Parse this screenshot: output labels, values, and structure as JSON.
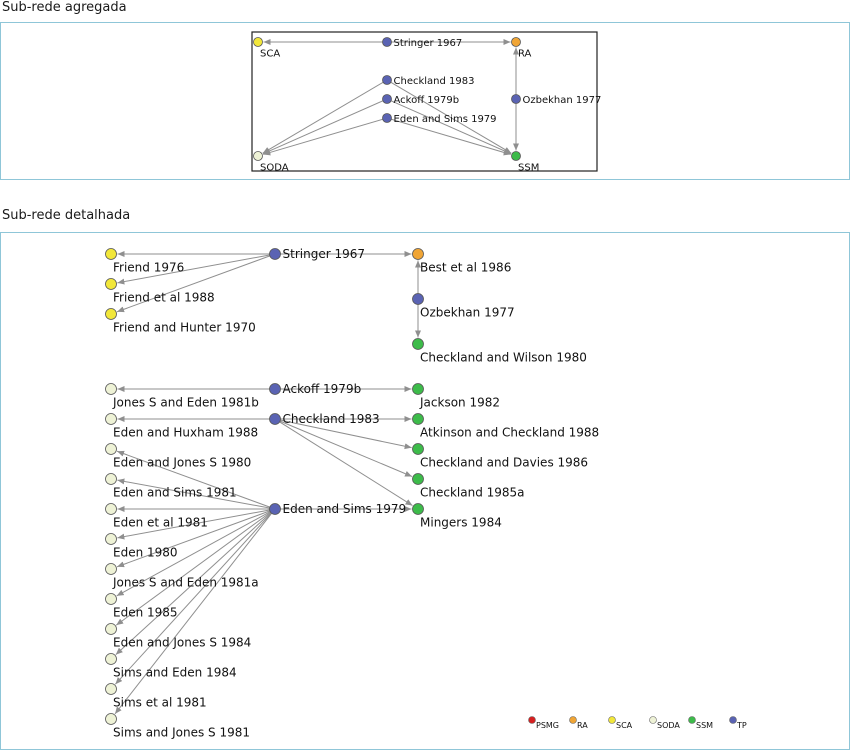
{
  "aggregated": {
    "title": "Sub-rede agregada",
    "nodes": [
      {
        "id": "sca",
        "label": "SCA",
        "group": "SCA"
      },
      {
        "id": "stringer",
        "label": "Stringer 1967",
        "group": "TP"
      },
      {
        "id": "ra",
        "label": "RA",
        "group": "RA"
      },
      {
        "id": "checkland1983",
        "label": "Checkland 1983",
        "group": "TP"
      },
      {
        "id": "ackoff",
        "label": "Ackoff 1979b",
        "group": "TP"
      },
      {
        "id": "edensims",
        "label": "Eden and Sims 1979",
        "group": "TP"
      },
      {
        "id": "ozbekhan",
        "label": "Ozbekhan 1977",
        "group": "TP"
      },
      {
        "id": "soda",
        "label": "SODA",
        "group": "SODA"
      },
      {
        "id": "ssm",
        "label": "SSM",
        "group": "SSM"
      }
    ],
    "edges": [
      [
        "stringer",
        "sca"
      ],
      [
        "stringer",
        "ra"
      ],
      [
        "ozbekhan",
        "ra"
      ],
      [
        "ozbekhan",
        "ssm"
      ],
      [
        "checkland1983",
        "soda"
      ],
      [
        "ackoff",
        "soda"
      ],
      [
        "edensims",
        "soda"
      ],
      [
        "checkland1983",
        "ssm"
      ],
      [
        "ackoff",
        "ssm"
      ],
      [
        "edensims",
        "ssm"
      ]
    ]
  },
  "detailed": {
    "title": "Sub-rede detalhada",
    "nodes": [
      {
        "id": "friend1976",
        "label": "Friend 1976",
        "group": "SCA"
      },
      {
        "id": "friendetal1988",
        "label": "Friend et al 1988",
        "group": "SCA"
      },
      {
        "id": "friendhunter1970",
        "label": "Friend and Hunter 1970",
        "group": "SCA"
      },
      {
        "id": "stringer1967",
        "label": "Stringer 1967",
        "group": "TP"
      },
      {
        "id": "best1986",
        "label": "Best et al 1986",
        "group": "RA"
      },
      {
        "id": "ozbekhan1977",
        "label": "Ozbekhan 1977",
        "group": "TP"
      },
      {
        "id": "checklandwilson1980",
        "label": "Checkland and Wilson 1980",
        "group": "SSM"
      },
      {
        "id": "jonesseden1981b",
        "label": "Jones S and Eden 1981b",
        "group": "SODA"
      },
      {
        "id": "ackoff1979b",
        "label": "Ackoff 1979b",
        "group": "TP"
      },
      {
        "id": "jackson1982",
        "label": "Jackson 1982",
        "group": "SSM"
      },
      {
        "id": "edenhuxham1988",
        "label": "Eden and Huxham 1988",
        "group": "SODA"
      },
      {
        "id": "checkland1983",
        "label": "Checkland 1983",
        "group": "TP"
      },
      {
        "id": "atkinsoncheckland1988",
        "label": "Atkinson and Checkland 1988",
        "group": "SSM"
      },
      {
        "id": "edenjoness1980",
        "label": "Eden and Jones S 1980",
        "group": "SODA"
      },
      {
        "id": "checklanddavies1986",
        "label": "Checkland and Davies 1986",
        "group": "SSM"
      },
      {
        "id": "edensims1981",
        "label": "Eden and Sims 1981",
        "group": "SODA"
      },
      {
        "id": "checkland1985a",
        "label": "Checkland 1985a",
        "group": "SSM"
      },
      {
        "id": "edenetal1981",
        "label": "Eden et al 1981",
        "group": "SODA"
      },
      {
        "id": "edensims1979",
        "label": "Eden and Sims 1979",
        "group": "TP"
      },
      {
        "id": "mingers1984",
        "label": "Mingers 1984",
        "group": "SSM"
      },
      {
        "id": "eden1980",
        "label": "Eden 1980",
        "group": "SODA"
      },
      {
        "id": "jonesseden1981a",
        "label": "Jones S and Eden 1981a",
        "group": "SODA"
      },
      {
        "id": "eden1985",
        "label": "Eden 1985",
        "group": "SODA"
      },
      {
        "id": "edenjoness1984",
        "label": "Eden and Jones S 1984",
        "group": "SODA"
      },
      {
        "id": "simseden1984",
        "label": "Sims and Eden 1984",
        "group": "SODA"
      },
      {
        "id": "simsetal1981",
        "label": "Sims et al 1981",
        "group": "SODA"
      },
      {
        "id": "simsjoness1981",
        "label": "Sims and Jones S 1981",
        "group": "SODA"
      }
    ],
    "edges": [
      [
        "stringer1967",
        "friend1976"
      ],
      [
        "stringer1967",
        "friendetal1988"
      ],
      [
        "stringer1967",
        "friendhunter1970"
      ],
      [
        "stringer1967",
        "best1986"
      ],
      [
        "ozbekhan1977",
        "best1986"
      ],
      [
        "ozbekhan1977",
        "checklandwilson1980"
      ],
      [
        "ackoff1979b",
        "jonesseden1981b"
      ],
      [
        "ackoff1979b",
        "jackson1982"
      ],
      [
        "checkland1983",
        "edenhuxham1988"
      ],
      [
        "checkland1983",
        "atkinsoncheckland1988"
      ],
      [
        "checkland1983",
        "checklanddavies1986"
      ],
      [
        "checkland1983",
        "checkland1985a"
      ],
      [
        "checkland1983",
        "mingers1984"
      ],
      [
        "edensims1979",
        "mingers1984"
      ],
      [
        "edensims1979",
        "edenjoness1980"
      ],
      [
        "edensims1979",
        "edensims1981"
      ],
      [
        "edensims1979",
        "edenetal1981"
      ],
      [
        "edensims1979",
        "eden1980"
      ],
      [
        "edensims1979",
        "jonesseden1981a"
      ],
      [
        "edensims1979",
        "eden1985"
      ],
      [
        "edensims1979",
        "edenjoness1984"
      ],
      [
        "edensims1979",
        "simseden1984"
      ],
      [
        "edensims1979",
        "simsetal1981"
      ],
      [
        "edensims1979",
        "simsjoness1981"
      ]
    ]
  },
  "legend": [
    {
      "key": "PSMG",
      "label": "PSMG"
    },
    {
      "key": "RA",
      "label": "RA"
    },
    {
      "key": "SCA",
      "label": "SCA"
    },
    {
      "key": "SODA",
      "label": "SODA"
    },
    {
      "key": "SSM",
      "label": "SSM"
    },
    {
      "key": "TP",
      "label": "TP"
    }
  ],
  "colors": {
    "PSMG": "#d62020",
    "RA": "#f0a535",
    "SCA": "#f2e73a",
    "SODA": "#eef2d6",
    "SSM": "#3dbb4a",
    "TP": "#5a63b3",
    "edge": "#8f8f8f",
    "frame": "#8fc6d8"
  }
}
